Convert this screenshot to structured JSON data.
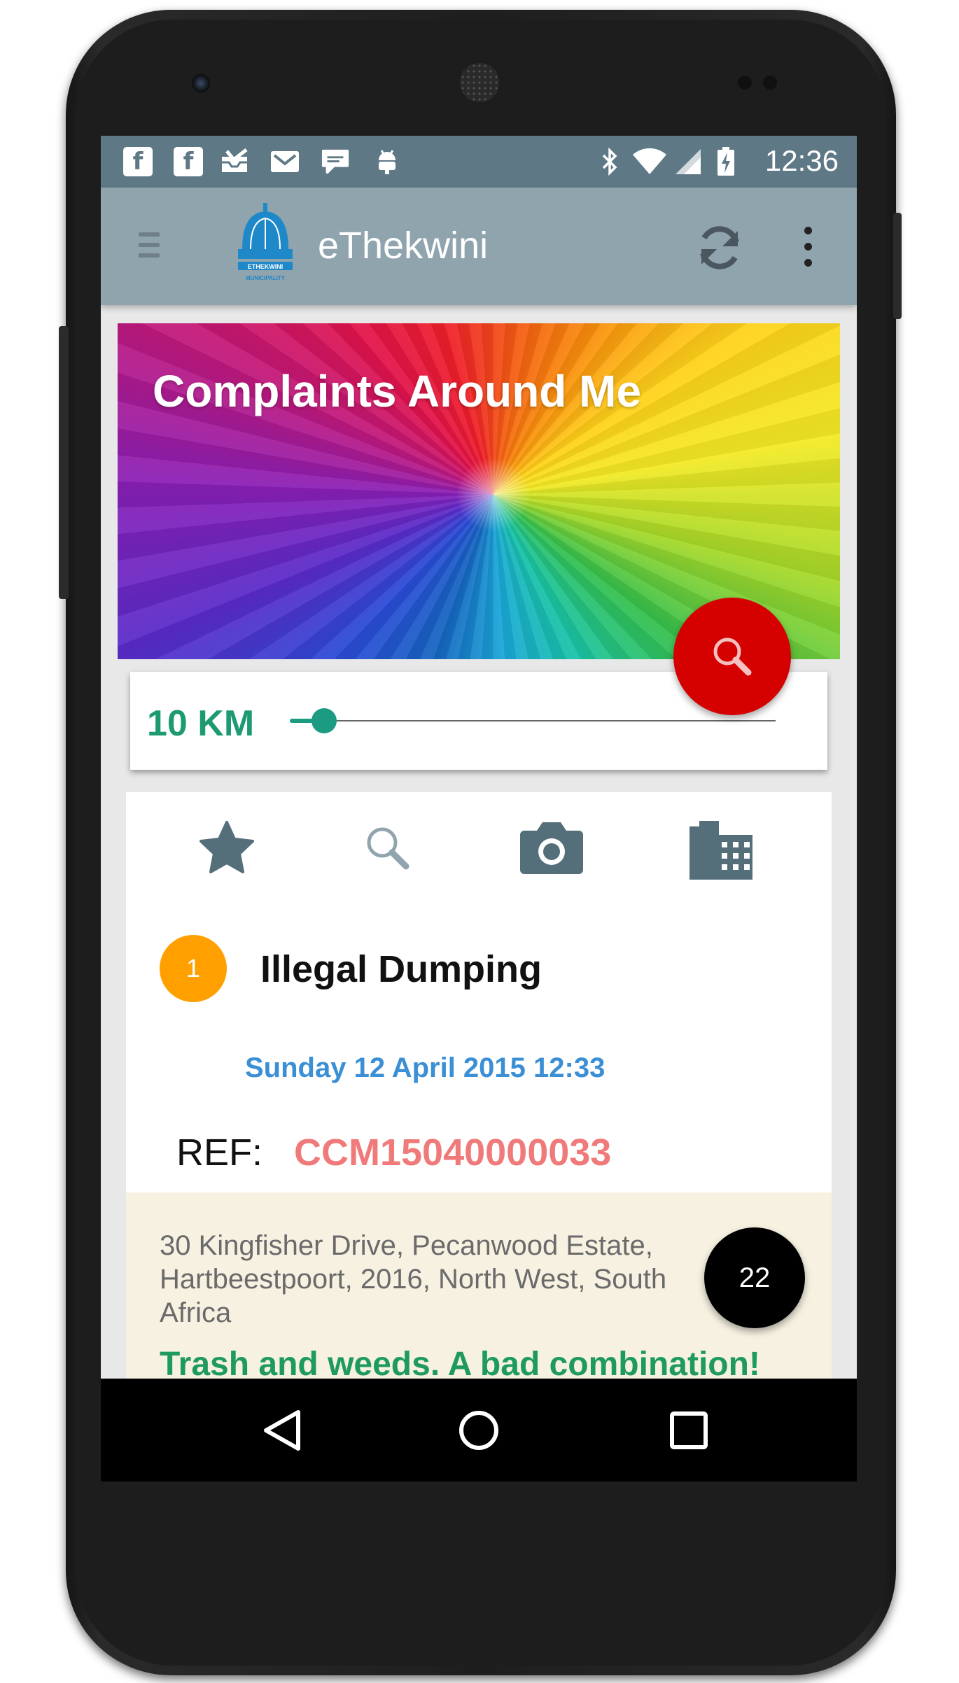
{
  "status_bar": {
    "time": "12:36",
    "notification_icons": [
      "facebook-icon",
      "facebook-icon",
      "inbox-icon",
      "gmail-icon",
      "hangouts-icon",
      "android-icon"
    ],
    "system_icons": [
      "bluetooth-icon",
      "wifi-icon",
      "signal-icon",
      "battery-charging-icon"
    ]
  },
  "app_bar": {
    "title": "eThekwini",
    "logo": "ethekwini-municipality-logo"
  },
  "hero": {
    "title": "Complaints Around Me"
  },
  "radius": {
    "label": "10 KM",
    "slider_fraction": 0.07
  },
  "tabs": [
    "star-icon",
    "search-icon",
    "camera-icon",
    "buildings-icon"
  ],
  "complaint": {
    "number": "1",
    "title": "Illegal Dumping",
    "date": "Sunday 12 April 2015 12:33",
    "ref_label": "REF:",
    "ref_value": "CCM15040000033",
    "address": "30 Kingfisher Drive, Pecanwood Estate, Hartbeestpoort, 2016, North West, South Africa",
    "description": "Trash and weeds. A bad combination!"
  },
  "count_bubble": "22",
  "colors": {
    "status_bar": "#5f7886",
    "app_bar": "#90a4ae",
    "accent_green": "#1e9a73",
    "fab_red": "#d50000",
    "badge_orange": "#ffa000",
    "date_blue": "#3b8fd4",
    "ref_red": "#f07a7a",
    "detail_bg": "#f6f1e1"
  }
}
